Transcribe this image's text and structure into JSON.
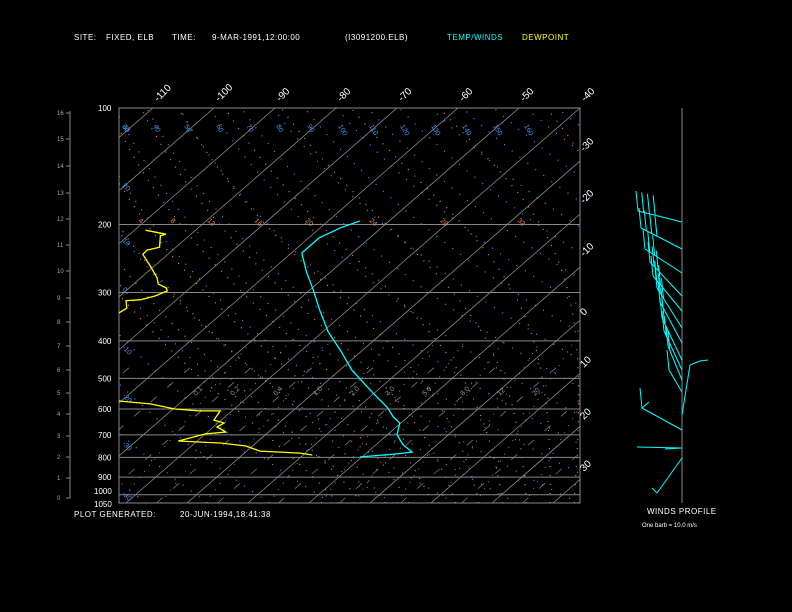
{
  "header": {
    "site_label": "SITE:",
    "site": "FIXED, ELB",
    "time_label": "TIME:",
    "time": "9-MAR-1991,12:00:00",
    "file": "(I3091200.ELB)",
    "legend_temp": "TEMP/WINDS",
    "legend_dew": "DEWPOINT"
  },
  "footer": {
    "generated_label": "PLOT GENERATED:",
    "generated": "20-JUN-1994,18:41:38"
  },
  "winds": {
    "title": "WINDS PROFILE",
    "note": "One barb = 10.0 m/s"
  },
  "colors": {
    "temp": "#00ffff",
    "dewpoint": "#ffff00",
    "dry_adiabat": "#4499ff",
    "moist_adiabat": "#ee8855",
    "grid": "#888888"
  },
  "chart_data": {
    "type": "line",
    "subtype": "skew-T log-P",
    "pressure_levels": [
      100,
      200,
      300,
      400,
      500,
      600,
      700,
      800,
      900,
      1000,
      1050
    ],
    "pressure_labels": [
      "100",
      "200",
      "300",
      "400",
      "500",
      "600",
      "700",
      "800",
      "900",
      "1000",
      "1050"
    ],
    "ylim_hpa": [
      1050,
      100
    ],
    "altitude_km_ticks": [
      "0",
      "1",
      "2",
      "3",
      "4",
      "5",
      "6",
      "7",
      "8",
      "9",
      "10",
      "11",
      "12",
      "13",
      "14",
      "15",
      "16"
    ],
    "isotherm_top_labels": [
      "-110",
      "-100",
      "-90",
      "-80",
      "-70",
      "-60",
      "-50",
      "-40"
    ],
    "isotherm_right_labels": [
      "-30",
      "-20",
      "-10",
      "0",
      "10",
      "20",
      "30"
    ],
    "dry_adiabat_labels": [
      "30",
      "40",
      "50",
      "60",
      "70",
      "80",
      "90",
      "100",
      "110",
      "120",
      "130",
      "140",
      "150",
      "160"
    ],
    "dry_adiabat_left_labels": [
      "30",
      "20",
      "10",
      "0",
      "-10",
      "-20",
      "-30",
      "-40"
    ],
    "moist_adiabat_labels": [
      "4",
      "8",
      "12",
      "16",
      "20",
      "24",
      "28",
      "32"
    ],
    "mixing_ratio_labels": [
      "0.1",
      "0.2",
      "0.4",
      "1.0",
      "2.0",
      "3.0",
      "5.0",
      "8.0",
      "12",
      "20"
    ],
    "series": [
      {
        "name": "TEMP/WINDS",
        "points_p_T": [
          [
            196,
            -54.8
          ],
          [
            204,
            -56.7
          ],
          [
            217,
            -58.3
          ],
          [
            237,
            -58.3
          ],
          [
            265,
            -54.0
          ],
          [
            295,
            -49.5
          ],
          [
            333,
            -44.6
          ],
          [
            379,
            -39.1
          ],
          [
            425,
            -33.4
          ],
          [
            476,
            -28.0
          ],
          [
            546,
            -20.2
          ],
          [
            593,
            -15.3
          ],
          [
            629,
            -12.4
          ],
          [
            652,
            -10.2
          ],
          [
            700,
            -8.4
          ],
          [
            743,
            -5.5
          ],
          [
            775,
            -2.7
          ],
          [
            784,
            -4.8
          ],
          [
            798,
            -10.3
          ]
        ]
      },
      {
        "name": "DEWPOINT",
        "segments_p_T": [
          [
            [
              207,
              -88.2
            ],
            [
              212,
              -84.1
            ],
            [
              214,
              -84.7
            ],
            [
              229,
              -82.7
            ],
            [
              233,
              -84.2
            ],
            [
              239,
              -84.1
            ],
            [
              256,
              -80.7
            ],
            [
              275,
              -77.3
            ],
            [
              285,
              -76.0
            ],
            [
              292,
              -73.9
            ],
            [
              297,
              -73.2
            ],
            [
              306,
              -74.2
            ],
            [
              313,
              -75.9
            ],
            [
              315,
              -78.1
            ],
            [
              329,
              -76.6
            ],
            [
              339,
              -77.0
            ]
          ],
          [
            [
              572,
              -60.4
            ],
            [
              582,
              -54.7
            ],
            [
              600,
              -49.7
            ],
            [
              607,
              -45.4
            ],
            [
              607,
              -41.9
            ],
            [
              641,
              -41.2
            ],
            [
              652,
              -39.0
            ],
            [
              668,
              -39.4
            ],
            [
              688,
              -37.0
            ],
            [
              696,
              -40.0
            ],
            [
              726,
              -43.1
            ],
            [
              735,
              -35.6
            ],
            [
              748,
              -31.1
            ],
            [
              771,
              -27.8
            ],
            [
              780,
              -20.9
            ],
            [
              789,
              -18.5
            ]
          ]
        ]
      }
    ]
  }
}
